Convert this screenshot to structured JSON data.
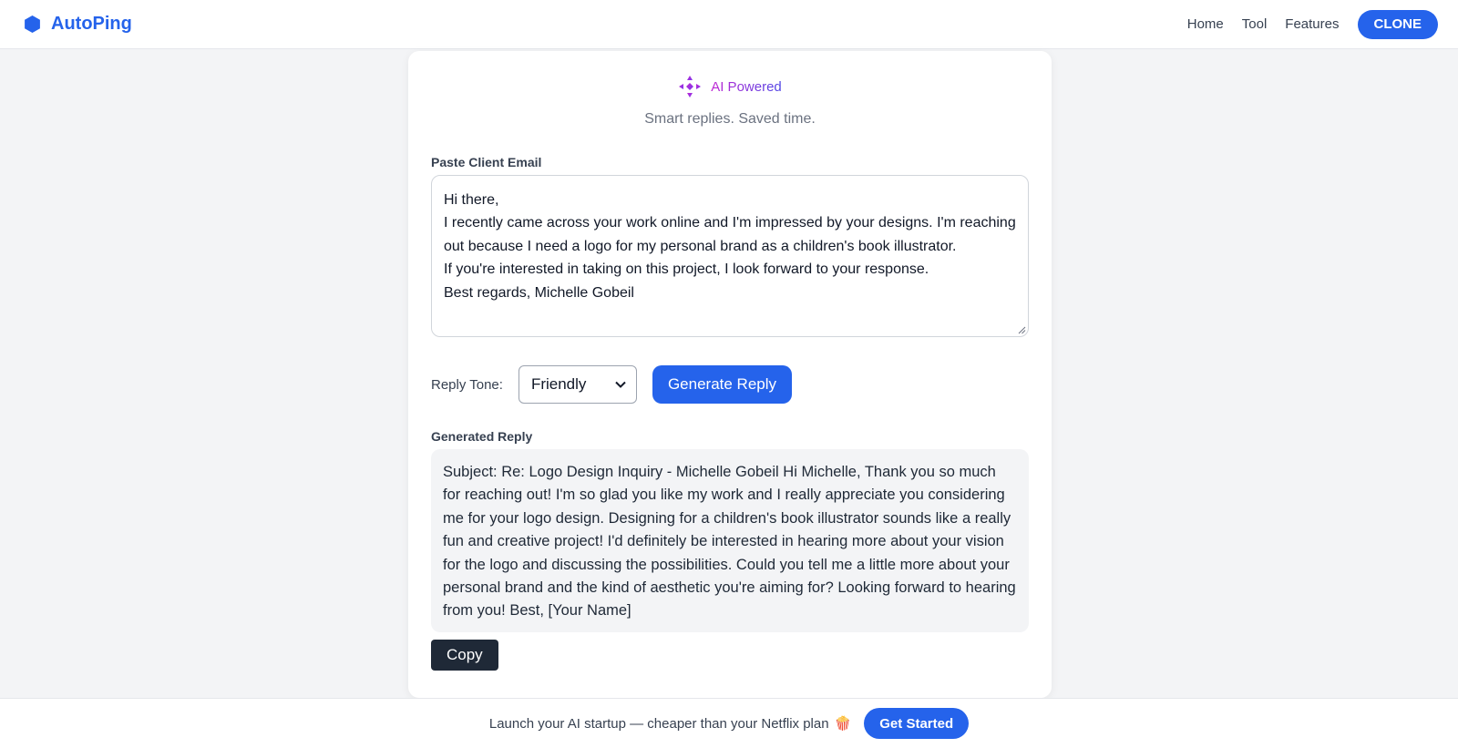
{
  "header": {
    "brand_name": "AutoPing",
    "nav": [
      "Home",
      "Tool",
      "Features"
    ],
    "clone_label": "CLONE"
  },
  "card": {
    "badge_text": "AI Powered",
    "tagline": "Smart replies. Saved time.",
    "email_label": "Paste Client Email",
    "email_lines": [
      "Hi there,",
      "I recently came across your work online and I'm impressed by your designs. I'm reaching out because I need a logo for my personal brand as a children's book illustrator.",
      "If you're interested in taking on this project, I look forward to your response.",
      "Best regards, Michelle Gobeil"
    ],
    "tone_label": "Reply Tone:",
    "tone_selected": "Friendly",
    "generate_label": "Generate Reply",
    "reply_label": "Generated Reply",
    "reply_text": "Subject: Re: Logo Design Inquiry - Michelle Gobeil Hi Michelle, Thank you so much for reaching out! I'm so glad you like my work and I really appreciate you considering me for your logo design. Designing for a children's book illustrator sounds like a really fun and creative project! I'd definitely be interested in hearing more about your vision for the logo and discussing the possibilities. Could you tell me a little more about your personal brand and the kind of aesthetic you're aiming for? Looking forward to hearing from you! Best, [Your Name]",
    "copy_label": "Copy"
  },
  "footer": {
    "text": "Launch your AI startup — cheaper than your Netflix plan",
    "emoji": "🍿",
    "cta_label": "Get Started"
  },
  "colors": {
    "accent": "#2563eb",
    "dark_button": "#1f2937",
    "background": "#f3f4f6"
  },
  "icons": {
    "brand": "hexagon-logo-icon",
    "badge": "sparkle-arrows-icon",
    "select": "chevron-down-icon"
  }
}
